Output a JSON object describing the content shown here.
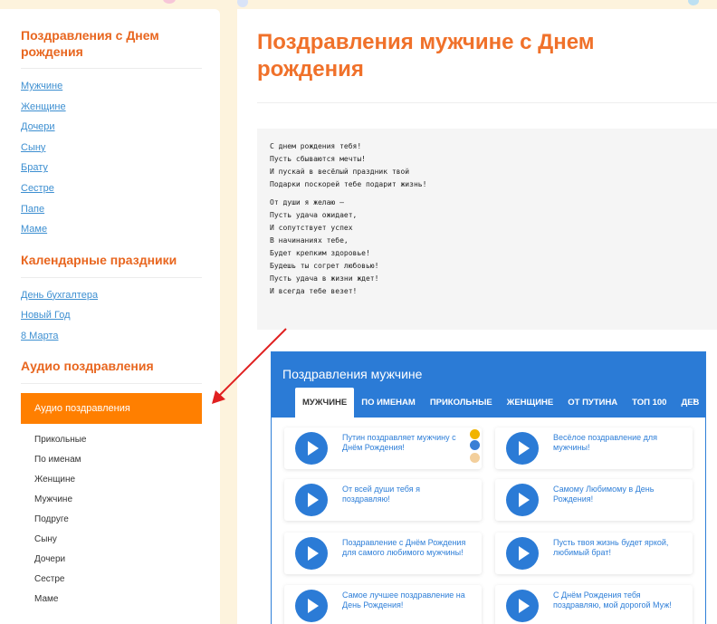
{
  "sidebar": {
    "birthday_title": "Поздравления с Днем рождения",
    "birthday_links": [
      "Мужчине",
      "Женщине",
      "Дочери",
      "Сыну",
      "Брату",
      "Сестре",
      "Папе",
      "Маме"
    ],
    "calendar_title": "Календарные праздники",
    "calendar_links": [
      "День бухгалтера",
      "Новый Год",
      "8 Марта"
    ],
    "audio_title": "Аудио поздравления",
    "audio_button": "Аудио поздравления",
    "audio_sub": [
      "Прикольные",
      "По именам",
      "Женщине",
      "Мужчине",
      "Подруге",
      "Сыну",
      "Дочери",
      "Сестре",
      "Маме"
    ]
  },
  "main": {
    "title": "Поздравления мужчине с Днем рождения",
    "poem_stanza1": [
      "С днем рождения тебя!",
      "Пусть сбываются мечты!",
      "И пускай в весёлый праздник твой",
      "Подарки поскорей тебе подарит жизнь!"
    ],
    "poem_stanza2": [
      "От души я желаю –",
      "Пусть удача ожидает,",
      "И сопутствует успех",
      "В начинаниях тебе,",
      "Будет крепким здоровье!",
      "Будешь ты согрет любовью!",
      "Пусть удача в жизни ждет!",
      "И всегда тебе везет!"
    ]
  },
  "widget": {
    "title": "Поздравления мужчине",
    "tabs": [
      "МУЖЧИНЕ",
      "ПО ИМЕНАМ",
      "ПРИКОЛЬНЫЕ",
      "ЖЕНЩИНЕ",
      "ОТ ПУТИНА",
      "ТОП 100",
      "ДЕВ"
    ],
    "arrow": "›",
    "cards": [
      "Путин поздравляет мужчину с Днём Рождения!",
      "Весёлое поздравление для мужчины!",
      "От всей души тебя я поздравляю!",
      "Самому Любимому в День Рождения!",
      "Поздравление с Днём Рождения для самого любимого мужчины!",
      "Пусть твоя жизнь будет яркой, любимый брат!",
      "Самое лучшее поздравление на День Рождения!",
      "С Днём Рождения тебя поздравляю, мой дорогой Муж!"
    ]
  },
  "colors": {
    "accent": "#f0712a",
    "link": "#3d8fd1",
    "widget_blue": "#2b7bd6",
    "button_orange": "#ff7f00"
  }
}
